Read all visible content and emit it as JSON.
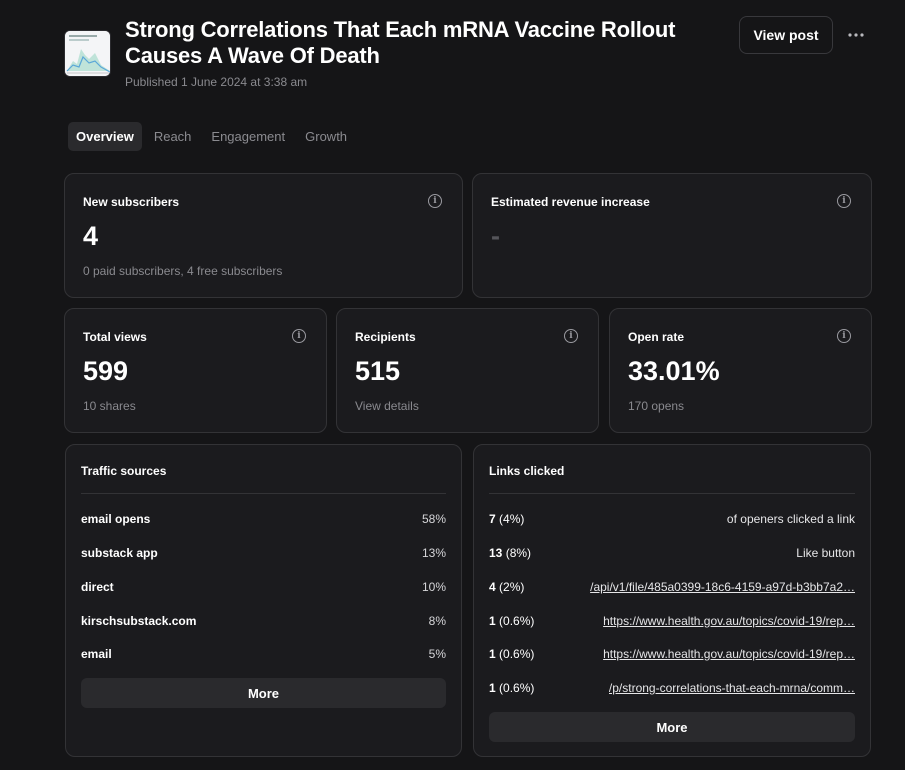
{
  "post": {
    "title": "Strong Correlations That Each mRNA Vaccine Rollout Causes A Wave Of Death",
    "published": "Published 1 June 2024 at 3:38 am",
    "view_post_label": "View post",
    "more_icon": "more-horizontal-icon"
  },
  "tabs": [
    "Overview",
    "Reach",
    "Engagement",
    "Growth"
  ],
  "active_tab": "Overview",
  "stats": {
    "new_subscribers": {
      "label": "New subscribers",
      "value": "4",
      "sub": "0 paid subscribers, 4 free subscribers"
    },
    "revenue": {
      "label": "Estimated revenue increase",
      "value": "-"
    },
    "total_views": {
      "label": "Total views",
      "value": "599",
      "sub": "10 shares"
    },
    "recipients": {
      "label": "Recipients",
      "value": "515",
      "sub": "View details"
    },
    "open_rate": {
      "label": "Open rate",
      "value": "33.01%",
      "sub": "170 opens"
    }
  },
  "traffic": {
    "title": "Traffic sources",
    "rows": [
      {
        "name": "email opens",
        "pct": "58%"
      },
      {
        "name": "substack app",
        "pct": "13%"
      },
      {
        "name": "direct",
        "pct": "10%"
      },
      {
        "name": "kirschsubstack.com",
        "pct": "8%"
      },
      {
        "name": "email",
        "pct": "5%"
      }
    ],
    "more_label": "More"
  },
  "links": {
    "title": "Links clicked",
    "rows": [
      {
        "count": "7",
        "pct": "(4%)",
        "text": "of openers clicked a link"
      },
      {
        "count": "13",
        "pct": "(8%)",
        "text": "Like button"
      },
      {
        "count": "4",
        "pct": "(2%)",
        "text": "/api/v1/file/485a0399-18c6-4159-a97d-b3bb7a2…"
      },
      {
        "count": "1",
        "pct": "(0.6%)",
        "text": "https://www.health.gov.au/topics/covid-19/rep…"
      },
      {
        "count": "1",
        "pct": "(0.6%)",
        "text": "https://www.health.gov.au/topics/covid-19/rep…"
      },
      {
        "count": "1",
        "pct": "(0.6%)",
        "text": "/p/strong-correlations-that-each-mrna/comm…"
      }
    ],
    "more_label": "More"
  },
  "colors": {
    "background": "#151517",
    "card": "#1b1b1e",
    "border": "#333336",
    "button": "#2a2a2d",
    "muted_text": "#8a8a8f"
  }
}
